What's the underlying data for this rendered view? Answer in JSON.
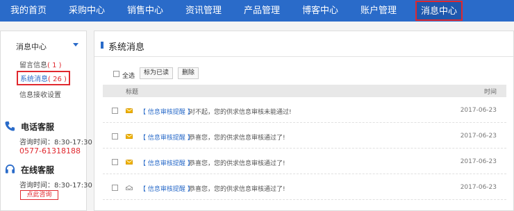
{
  "nav": {
    "items": [
      "我的首页",
      "采购中心",
      "销售中心",
      "资讯管理",
      "产品管理",
      "博客中心",
      "账户管理",
      "消息中心"
    ]
  },
  "sidebar": {
    "heading": "消息中心",
    "links": [
      {
        "label": "留言信息",
        "count": "( 1 )"
      },
      {
        "label": "系统消息",
        "count": "( 26 )"
      },
      {
        "label": "信息接收设置",
        "count": ""
      }
    ],
    "phone_service": {
      "title": "电话客服",
      "hours": "咨询时间：8:30-17:30",
      "phone": "0577-61318188"
    },
    "online_service": {
      "title": "在线客服",
      "hours": "咨询时间：8:30-17:30",
      "button": "点此咨询"
    }
  },
  "main": {
    "title": "系统消息",
    "toolbar": {
      "select_all": "全选",
      "mark_read": "标为已读",
      "delete": "删除"
    },
    "columns": {
      "title": "标题",
      "time": "时间"
    },
    "messages": [
      {
        "tag": "【 信息审核提醒 】",
        "text": "对不起，您的供求信息审核未能通过!",
        "date": "2017-06-23",
        "icon": "envelope-unread-icon"
      },
      {
        "tag": "【 信息审核提醒 】",
        "text": "恭喜您，您的供求信息审核通过了!",
        "date": "2017-06-23",
        "icon": "envelope-unread-icon"
      },
      {
        "tag": "【 信息审核提醒 】",
        "text": "恭喜您，您的供求信息审核通过了!",
        "date": "2017-06-23",
        "icon": "envelope-unread-icon"
      },
      {
        "tag": "【 信息审核提醒 】",
        "text": "恭喜您，您的供求信息审核通过了!",
        "date": "2017-06-23",
        "icon": "envelope-read-icon"
      }
    ]
  },
  "colors": {
    "brand": "#2a6bc9",
    "highlight": "#e0282e",
    "unread": "#f0b400",
    "read": "#999999"
  }
}
